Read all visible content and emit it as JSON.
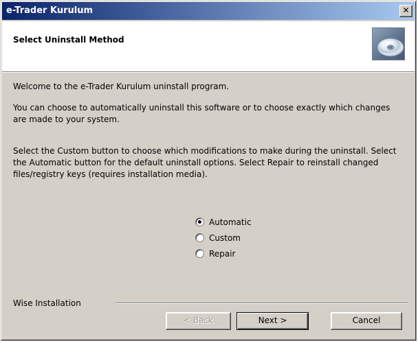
{
  "window": {
    "title": "e-Trader Kurulum",
    "close_glyph": "✕"
  },
  "header": {
    "title": "Select Uninstall Method",
    "icon": "cd-icon"
  },
  "body": {
    "welcome": "Welcome to the e-Trader Kurulum uninstall program.",
    "intro": "You can choose to automatically uninstall this software or to choose exactly which changes are made to your system.",
    "instructions": "Select the Custom button to choose which modifications to make during the uninstall. Select the Automatic button for the default uninstall options. Select Repair to reinstall changed files/registry keys (requires installation media)."
  },
  "options": [
    {
      "label": "Automatic",
      "checked": true
    },
    {
      "label": "Custom",
      "checked": false
    },
    {
      "label": "Repair",
      "checked": false
    }
  ],
  "footer": {
    "brand": "Wise Installation",
    "back_label": "< Back",
    "next_label": "Next >",
    "cancel_label": "Cancel"
  },
  "colors": {
    "titlebar_start": "#0a246a",
    "titlebar_end": "#a6caf0",
    "face": "#d4d0c8"
  }
}
